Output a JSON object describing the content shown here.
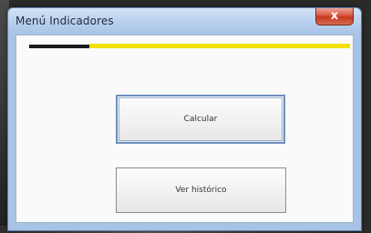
{
  "window": {
    "title": "Menú Indicadores",
    "close_symbol": "x"
  },
  "colors": {
    "accent_yellow": "#f2e100",
    "accent_black": "#1b1b1b",
    "close_red": "#d7563d"
  },
  "buttons": {
    "calcular": "Calcular",
    "historico": "Ver histórico"
  }
}
